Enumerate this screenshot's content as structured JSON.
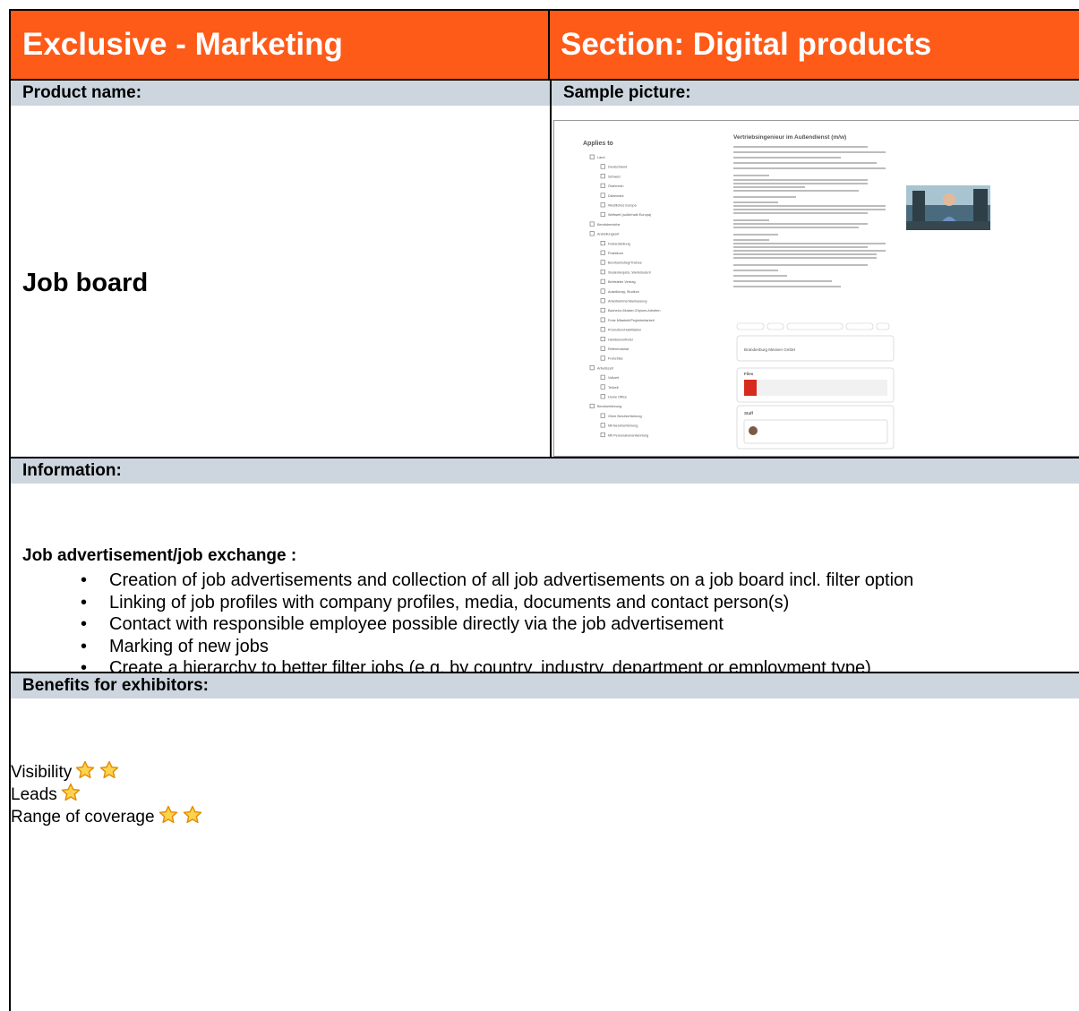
{
  "header": {
    "left_title": "Exclusive - Marketing",
    "right_title": "Section: Digital products"
  },
  "labels": {
    "product_name": "Product name:",
    "sample_picture": "Sample picture:",
    "information": "Information:",
    "benefits": "Benefits for exhibitors:"
  },
  "product": {
    "name": "Job board"
  },
  "information": {
    "title": "Job advertisement/job exchange :",
    "bullets": [
      "Creation of job advertisements and collection of all job advertisements on a job board incl. filter option",
      "Linking of job profiles with company profiles, media, documents and contact person(s)",
      "Contact with responsible employee possible directly via the job advertisement",
      "Marking of new jobs",
      "Create a hierarchy to better filter jobs (e.g. by country, industry, department or employment type)"
    ]
  },
  "benefits": [
    {
      "label": "Visibility",
      "stars": 2
    },
    {
      "label": "Leads",
      "stars": 1
    },
    {
      "label": "Range of coverage",
      "stars": 2
    }
  ],
  "colors": {
    "header_bg": "#fe5a18",
    "label_bg": "#cdd6de",
    "star_fill": "#fcd34d",
    "star_stroke": "#e38b00"
  },
  "sample_picture": {
    "filter_title": "Applies to",
    "job_title": "Vertriebsingenieur im Außendienst (m/w)",
    "filters": [
      "Land",
      "Deutschland",
      "Schweiz",
      "Österreich",
      "Dänemark",
      "Westliches Europa",
      "Weltweit (außerhalb Europa)",
      "Berufsbereiche",
      "Anstellungsart",
      "Festanstellung",
      "Praktikum",
      "Berufseinstieg/Trainee",
      "Studentenjobs, Werkstudent",
      "Befristeter Vertrag",
      "Ausbildung, Studium",
      "Arbeitnehmerüberlassung",
      "Bachelor-/Master-/Diplom-Arbeiten",
      "Freie Mitarbeit/Projektmitarbeit",
      "Promotion/Habilitation",
      "Handelsvertreter",
      "Referendariat",
      "Franchise",
      "Arbeitszeit",
      "Vollzeit",
      "Teilzeit",
      "Home Office",
      "Berufserfahrung",
      "Ohne Berufserfahrung",
      "Mit Berufserfahrung",
      "Mit Personalverantwortung"
    ],
    "company_box": "Brandenburg Messen GmbH",
    "files_title": "Files",
    "staff_title": "Staff"
  }
}
